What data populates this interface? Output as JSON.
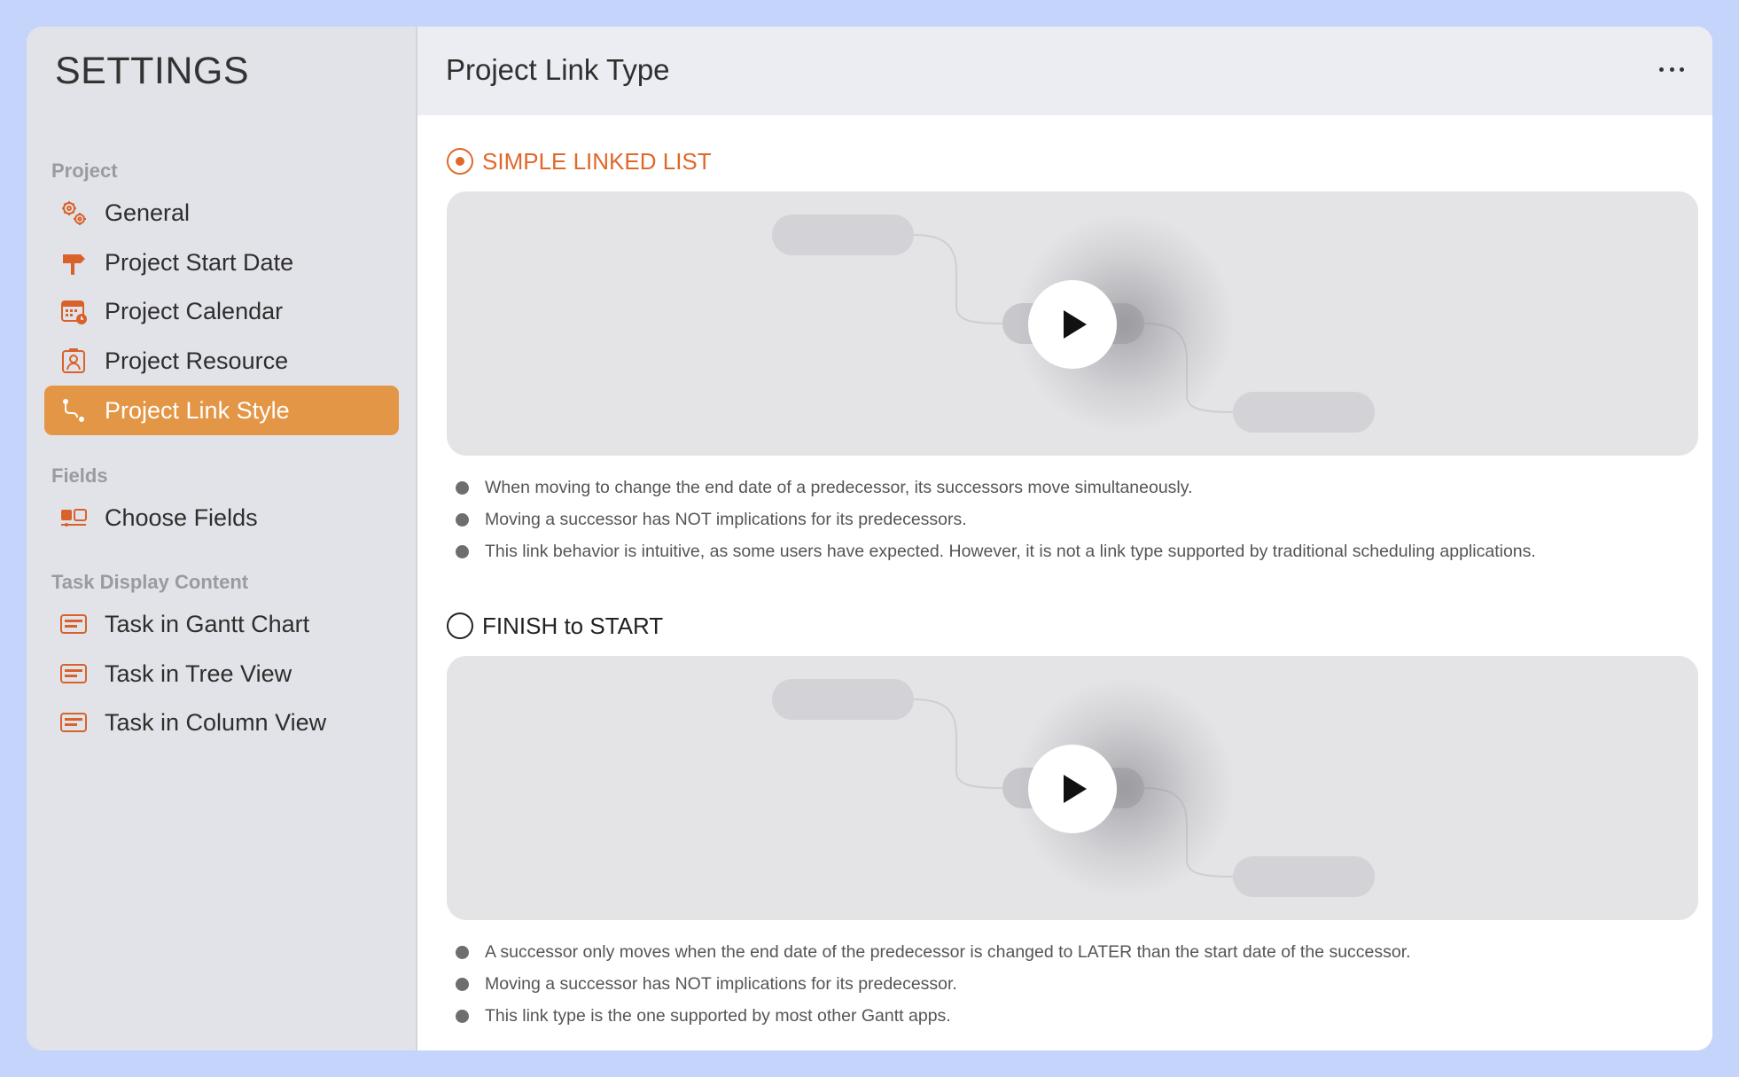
{
  "sidebar": {
    "title": "SETTINGS",
    "sections": [
      {
        "label": "Project",
        "items": [
          {
            "label": "General",
            "icon": "gears-icon"
          },
          {
            "label": "Project Start Date",
            "icon": "signpost-icon"
          },
          {
            "label": "Project Calendar",
            "icon": "calendar-clock-icon"
          },
          {
            "label": "Project Resource",
            "icon": "person-badge-icon"
          },
          {
            "label": "Project Link Style",
            "icon": "link-path-icon",
            "active": true
          }
        ]
      },
      {
        "label": "Fields",
        "items": [
          {
            "label": "Choose Fields",
            "icon": "fields-icon"
          }
        ]
      },
      {
        "label": "Task Display Content",
        "items": [
          {
            "label": "Task in Gantt Chart",
            "icon": "task-card-icon"
          },
          {
            "label": "Task in Tree View",
            "icon": "task-card-icon"
          },
          {
            "label": "Task in Column View",
            "icon": "task-card-icon"
          }
        ]
      }
    ]
  },
  "header": {
    "title": "Project Link Type",
    "more_icon": "ellipsis-icon"
  },
  "options": [
    {
      "title": "SIMPLE LINKED LIST",
      "selected": true,
      "bullets": [
        "When moving to change the end date of a predecessor, its successors move simultaneously.",
        "Moving a successor has NOT implications for its predecessors.",
        "This link behavior is intuitive, as some users have expected. However, it is not a link type supported by traditional scheduling applications."
      ]
    },
    {
      "title": "FINISH to START",
      "selected": false,
      "bullets": [
        "A successor only moves when the end date of the predecessor is changed to LATER than the start date of the successor.",
        "Moving a successor has NOT implications for its predecessor.",
        "This link type is the one supported by most other Gantt apps."
      ]
    }
  ],
  "colors": {
    "accent": "#e0682b",
    "active_nav": "#e39645",
    "background": "#c4d4fa",
    "sidebar": "#e2e3e8"
  }
}
